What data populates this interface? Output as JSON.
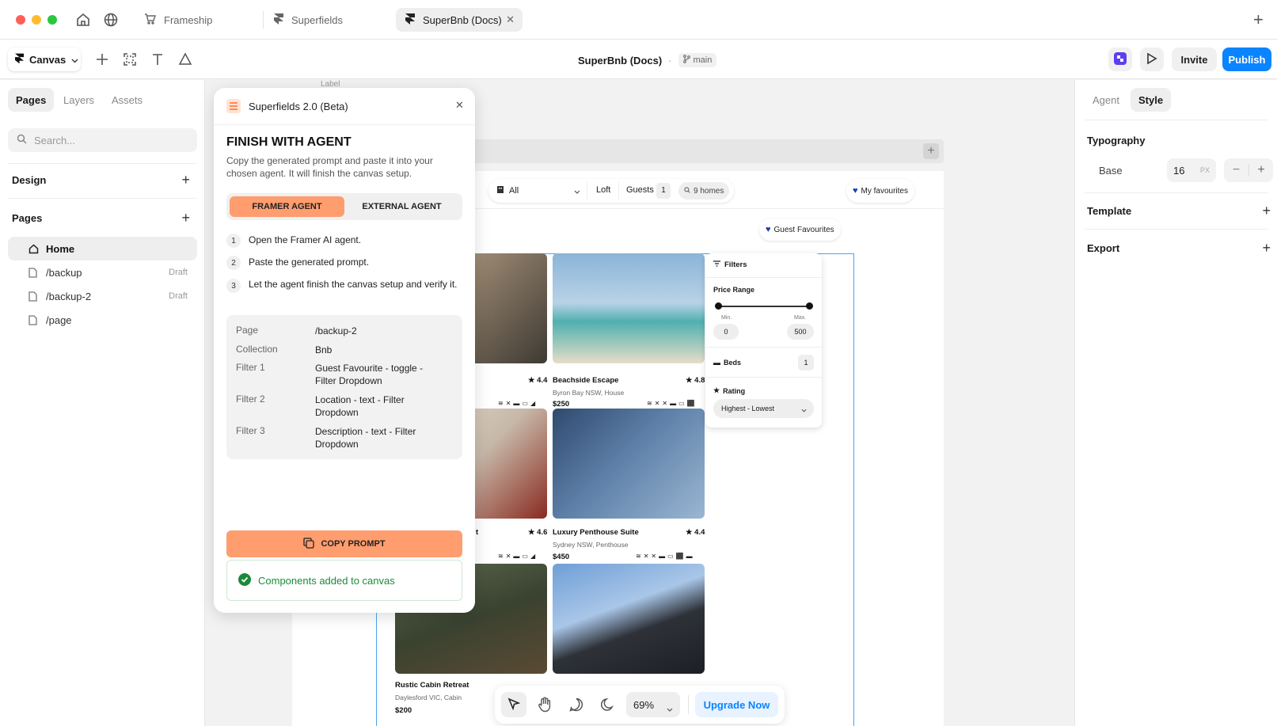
{
  "tabs": [
    {
      "label": "Frameship",
      "icon": "cart-icon"
    },
    {
      "label": "Superfields",
      "icon": "framer-icon"
    },
    {
      "label": "SuperBnb (Docs)",
      "icon": "framer-icon",
      "active": true
    }
  ],
  "toolbar": {
    "mode_label": "Canvas",
    "project_title": "SuperBnb (Docs)",
    "branch": "main",
    "invite_label": "Invite",
    "publish_label": "Publish"
  },
  "left": {
    "tabs": [
      "Pages",
      "Layers",
      "Assets"
    ],
    "search_placeholder": "Search...",
    "design_label": "Design",
    "pages_label": "Pages",
    "pages": [
      {
        "label": "Home",
        "draft": ""
      },
      {
        "label": "/backup",
        "draft": "Draft"
      },
      {
        "label": "/backup-2",
        "draft": "Draft"
      },
      {
        "label": "/page",
        "draft": ""
      }
    ]
  },
  "right": {
    "tabs": [
      "Agent",
      "Style"
    ],
    "typography_label": "Typography",
    "base_label": "Base",
    "base_value": "16",
    "base_unit": "PX",
    "template_label": "Template",
    "export_label": "Export"
  },
  "canvas": {
    "label_text": "Label",
    "filter_all": "All",
    "loft": "Loft",
    "guests_label": "Guests",
    "guests_count": "1",
    "homes": "9 homes",
    "my_favourites": "My favourites",
    "guest_favourites": "Guest Favourites",
    "filters_title": "Filters",
    "price_range": "Price Range",
    "min_label": "Min.",
    "max_label": "Max.",
    "min_value": "0",
    "max_value": "500",
    "beds_label": "Beds",
    "beds_value": "1",
    "rating_label": "Rating",
    "rating_value": "Highest - Lowest",
    "cards": [
      {
        "title": "",
        "sub": "",
        "price": "",
        "rating": "4.4"
      },
      {
        "title": "Beachside Escape",
        "sub": "Byron Bay NSW, House",
        "price": "$250",
        "rating": "4.8"
      },
      {
        "title": "t",
        "sub": "",
        "price": "",
        "rating": "4.6"
      },
      {
        "title": "Luxury Penthouse Suite",
        "sub": "Sydney NSW, Penthouse",
        "price": "$450",
        "rating": "4.4"
      },
      {
        "title": "Rustic Cabin Retreat",
        "sub": "Daylesford VIC, Cabin",
        "price": "$200",
        "rating": ""
      },
      {
        "title": "",
        "sub": "",
        "price": "",
        "rating": ""
      }
    ]
  },
  "plugin": {
    "title": "Superfields 2.0 (Beta)",
    "heading": "FINISH WITH AGENT",
    "description": "Copy the generated prompt and paste it into your chosen agent. It will finish the canvas setup.",
    "tab_framer": "FRAMER AGENT",
    "tab_external": "EXTERNAL AGENT",
    "steps": [
      {
        "num": "1",
        "text": "Open the Framer AI agent."
      },
      {
        "num": "2",
        "text": "Paste the generated prompt."
      },
      {
        "num": "3",
        "text": "Let the agent finish the canvas setup and verify it."
      }
    ],
    "details": [
      {
        "key": "Page",
        "value": "/backup-2"
      },
      {
        "key": "Collection",
        "value": "Bnb"
      },
      {
        "key": "Filter 1",
        "value": "Guest Favourite - toggle - Filter Dropdown"
      },
      {
        "key": "Filter 2",
        "value": "Location - text - Filter Dropdown"
      },
      {
        "key": "Filter 3",
        "value": "Description - text - Filter Dropdown"
      }
    ],
    "copy_label": "COPY PROMPT",
    "success_text": "Components added to canvas"
  },
  "bottom": {
    "zoom": "69%",
    "upgrade_label": "Upgrade Now"
  },
  "colors": {
    "accent": "#0a84ff",
    "orange": "#ff9d6f",
    "success": "#1a8a3a"
  }
}
